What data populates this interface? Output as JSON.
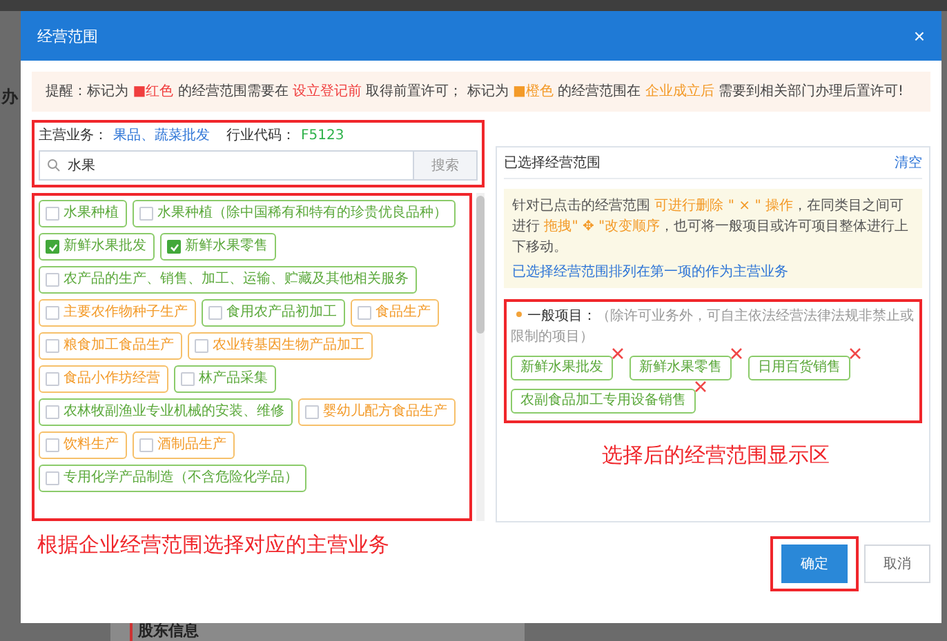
{
  "background": {
    "fragments": [
      "办",
      "股东信息"
    ]
  },
  "dialog": {
    "title": "经营范围",
    "close": "×"
  },
  "notice": [
    {
      "text": "提醒：标记为 ",
      "color": "#444444"
    },
    {
      "text": "■红色",
      "color": "#f03e3e"
    },
    {
      "text": " 的经营范围需要在 ",
      "color": "#444444"
    },
    {
      "text": "设立登记前",
      "color": "#f03e3e"
    },
    {
      "text": " 取得前置许可； 标记为 ",
      "color": "#444444"
    },
    {
      "text": "■橙色",
      "color": "#f39a28"
    },
    {
      "text": " 的经营范围在 ",
      "color": "#444444"
    },
    {
      "text": "企业成立后",
      "color": "#f39a28"
    },
    {
      "text": " 需要到相关部门办理后置许可!",
      "color": "#444444"
    }
  ],
  "main_business": {
    "label": "主营业务：",
    "value": "果品、蔬菜批发",
    "code_label": "行业代码：",
    "code": "F5123"
  },
  "search": {
    "value": "水果",
    "button": "搜索"
  },
  "scope_items": [
    {
      "label": "水果种植",
      "kind": "general",
      "checked": false
    },
    {
      "label": "水果种植（除中国稀有和特有的珍贵优良品种）",
      "kind": "general",
      "checked": false
    },
    {
      "label": "新鲜水果批发",
      "kind": "general",
      "checked": true
    },
    {
      "label": "新鲜水果零售",
      "kind": "general",
      "checked": true
    },
    {
      "label": "农产品的生产、销售、加工、运输、贮藏及其他相关服务",
      "kind": "general",
      "checked": false
    },
    {
      "label": "主要农作物种子生产",
      "kind": "permit",
      "checked": false
    },
    {
      "label": "食用农产品初加工",
      "kind": "general",
      "checked": false
    },
    {
      "label": "食品生产",
      "kind": "permit",
      "checked": false
    },
    {
      "label": "粮食加工食品生产",
      "kind": "permit",
      "checked": false
    },
    {
      "label": "农业转基因生物产品加工",
      "kind": "permit",
      "checked": false
    },
    {
      "label": "食品小作坊经营",
      "kind": "permit",
      "checked": false
    },
    {
      "label": "林产品采集",
      "kind": "general",
      "checked": false
    },
    {
      "label": "农林牧副渔业专业机械的安装、维修",
      "kind": "general",
      "checked": false
    },
    {
      "label": "婴幼儿配方食品生产",
      "kind": "permit",
      "checked": false
    },
    {
      "label": "饮料生产",
      "kind": "permit",
      "checked": false
    },
    {
      "label": "酒制品生产",
      "kind": "permit",
      "checked": false
    },
    {
      "label": "专用化学产品制造（不含危险化学品）",
      "kind": "general",
      "checked": false
    }
  ],
  "selected_panel": {
    "title": "已选择经营范围",
    "clear": "清空",
    "hint": [
      {
        "text": "针对已点击的经营范围 ",
        "color": "#555555"
      },
      {
        "text": "可进行删除 \" × \" 操作",
        "color": "#f39a28"
      },
      {
        "text": "，在同类目之间可进行 ",
        "color": "#555555"
      },
      {
        "text": "拖拽\" ✥ \"改变顺序",
        "color": "#f39a28"
      },
      {
        "text": "，也可将一般项目或许可项目整体进行上下移动。",
        "color": "#555555"
      }
    ],
    "hint_link": "已选择经营范围排列在第一项的作为主营业务",
    "group": {
      "title": "一般项目：",
      "note": "（除许可业务外，可自主依法经营法律法规非禁止或限制的项目）",
      "items": [
        {
          "label": "新鲜水果批发"
        },
        {
          "label": "新鲜水果零售"
        },
        {
          "label": "日用百货销售"
        },
        {
          "label": "农副食品加工专用设备销售"
        }
      ]
    }
  },
  "annotations": [
    {
      "text": "根据企业经营范围选择对应的主营业务"
    },
    {
      "text": "选择后的经营范围显示区"
    }
  ],
  "buttons": [
    {
      "label": "确定",
      "kind": "primary"
    },
    {
      "label": "取消",
      "kind": "default"
    }
  ]
}
